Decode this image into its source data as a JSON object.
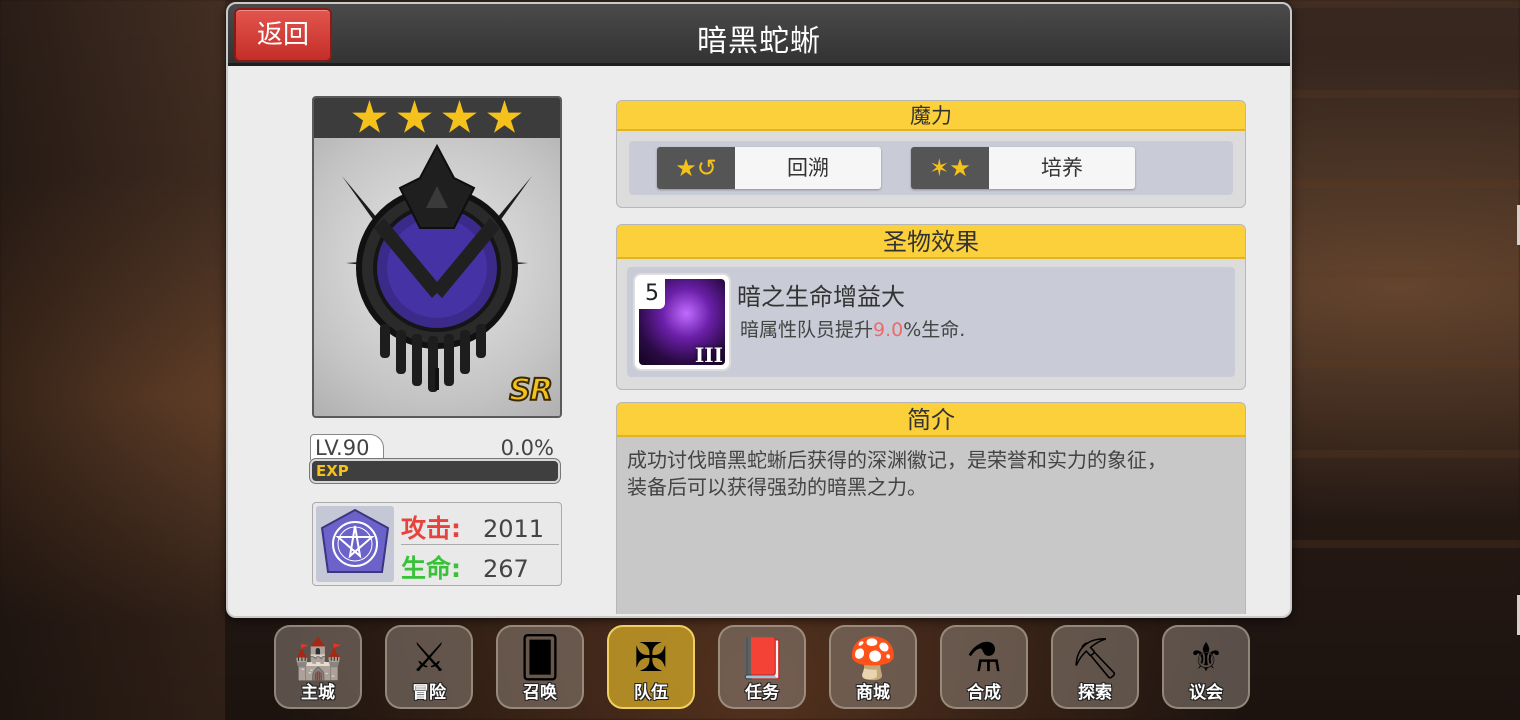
{
  "header": {
    "title": "暗黑蛇蜥",
    "back_label": "返回"
  },
  "relic": {
    "stars": 4,
    "rarity": "SR",
    "level": "LV.90",
    "exp_percent": "0.0%",
    "exp_fraction": 0.0,
    "exp_label": "EXP"
  },
  "stats": {
    "attack_label": "攻击:",
    "attack_value": "2011",
    "hp_label": "生命:",
    "hp_value": "267"
  },
  "magic_panel": {
    "heading": "魔力",
    "rewind_label": "回溯",
    "train_label": "培养"
  },
  "effect_panel": {
    "heading": "圣物效果",
    "skill_level": "5",
    "skill_rank": "III",
    "skill_name": "暗之生命增益大",
    "desc_prefix": "暗属性队员提升",
    "desc_value": "9.0",
    "desc_suffix": "%生命."
  },
  "intro_panel": {
    "heading": "简介",
    "text_line1": "成功讨伐暗黑蛇蜥后获得的深渊徽记，是荣誉和实力的象征，",
    "text_line2": "装备后可以获得强劲的暗黑之力。"
  },
  "nav": {
    "items": [
      {
        "label": "主城",
        "icon": "castle-icon"
      },
      {
        "label": "冒险",
        "icon": "axe-icon"
      },
      {
        "label": "召唤",
        "icon": "card-icon"
      },
      {
        "label": "队伍",
        "icon": "wings-crest-icon"
      },
      {
        "label": "任务",
        "icon": "book-icon"
      },
      {
        "label": "商城",
        "icon": "mushroom-shop-icon"
      },
      {
        "label": "合成",
        "icon": "potion-icon"
      },
      {
        "label": "探索",
        "icon": "shovel-icon"
      },
      {
        "label": "议会",
        "icon": "council-crest-icon"
      }
    ],
    "active_index": 3
  },
  "colors": {
    "accent_yellow": "#fcd03b",
    "back_red": "#d9403a",
    "attack_red": "#e8423d",
    "hp_green": "#38c238",
    "highlight_pink": "#ee6a6a",
    "star_gold": "#f5c21b"
  }
}
